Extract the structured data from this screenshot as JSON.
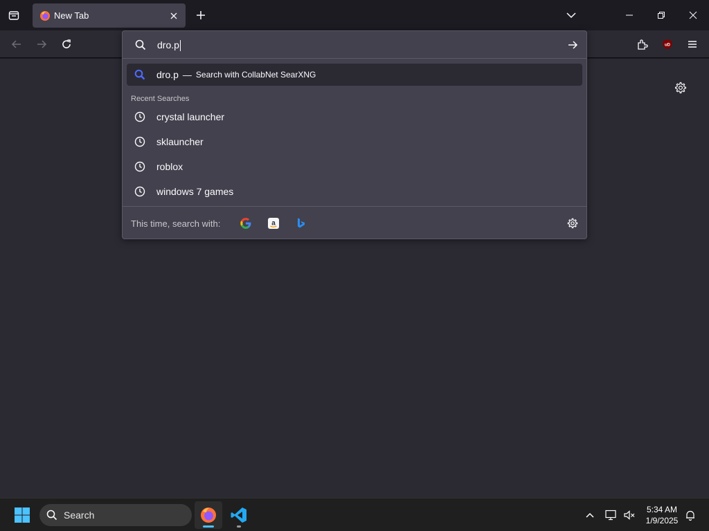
{
  "tab": {
    "title": "New Tab"
  },
  "urlbar": {
    "value": "dro.p",
    "selected_result": {
      "query": "dro.p",
      "separator": "—",
      "action": "Search with CollabNet SearXNG"
    },
    "group_label": "Recent Searches",
    "recent": [
      {
        "label": "crystal launcher"
      },
      {
        "label": "sklauncher"
      },
      {
        "label": "roblox"
      },
      {
        "label": "windows 7 games"
      }
    ],
    "oneoff_label": "This time, search with:",
    "engines": [
      "google-icon",
      "amazon-icon",
      "bing-icon"
    ]
  },
  "taskbar": {
    "search_label": "Search",
    "time": "5:34 AM",
    "date": "1/9/2025"
  },
  "colors": {
    "accent": "#0060df",
    "search_icon_blue": "#4f6bff",
    "ublock": "#800000",
    "windows_blue": "#4cc2ff"
  }
}
